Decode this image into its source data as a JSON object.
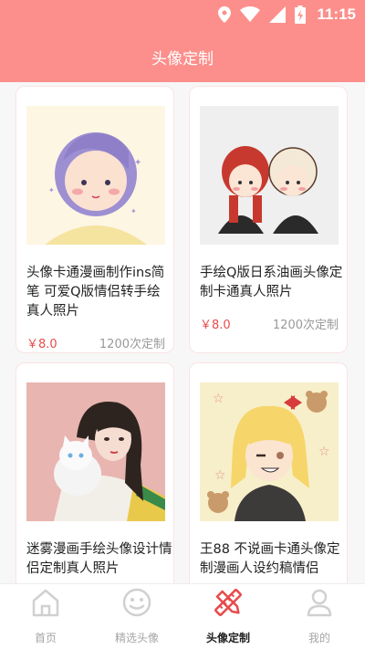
{
  "status": {
    "time": "11:15"
  },
  "header": {
    "title": "头像定制"
  },
  "products": [
    {
      "name": "头像卡通漫画制作ins简笔 可爱Q版情侣转手绘真人照片",
      "price": "￥8.0",
      "sales": "1200次定制"
    },
    {
      "name": "手绘Q版日系油画头像定制卡通真人照片",
      "price": "￥8.0",
      "sales": "1200次定制"
    },
    {
      "name": "迷雾漫画手绘头像设计情侣定制真人照片",
      "price": "",
      "sales": ""
    },
    {
      "name": "王88 不说画卡通头像定制漫画人设约稿情侣",
      "price": "",
      "sales": ""
    }
  ],
  "tabs": [
    {
      "label": "首页",
      "icon": "home-icon"
    },
    {
      "label": "精选头像",
      "icon": "smiley-icon"
    },
    {
      "label": "头像定制",
      "icon": "pen-ruler-icon",
      "active": true
    },
    {
      "label": "我的",
      "icon": "user-icon"
    }
  ],
  "colors": {
    "accent": "#fc8f8b",
    "price": "#e84b4b",
    "active_tab": "#e84b4b"
  }
}
